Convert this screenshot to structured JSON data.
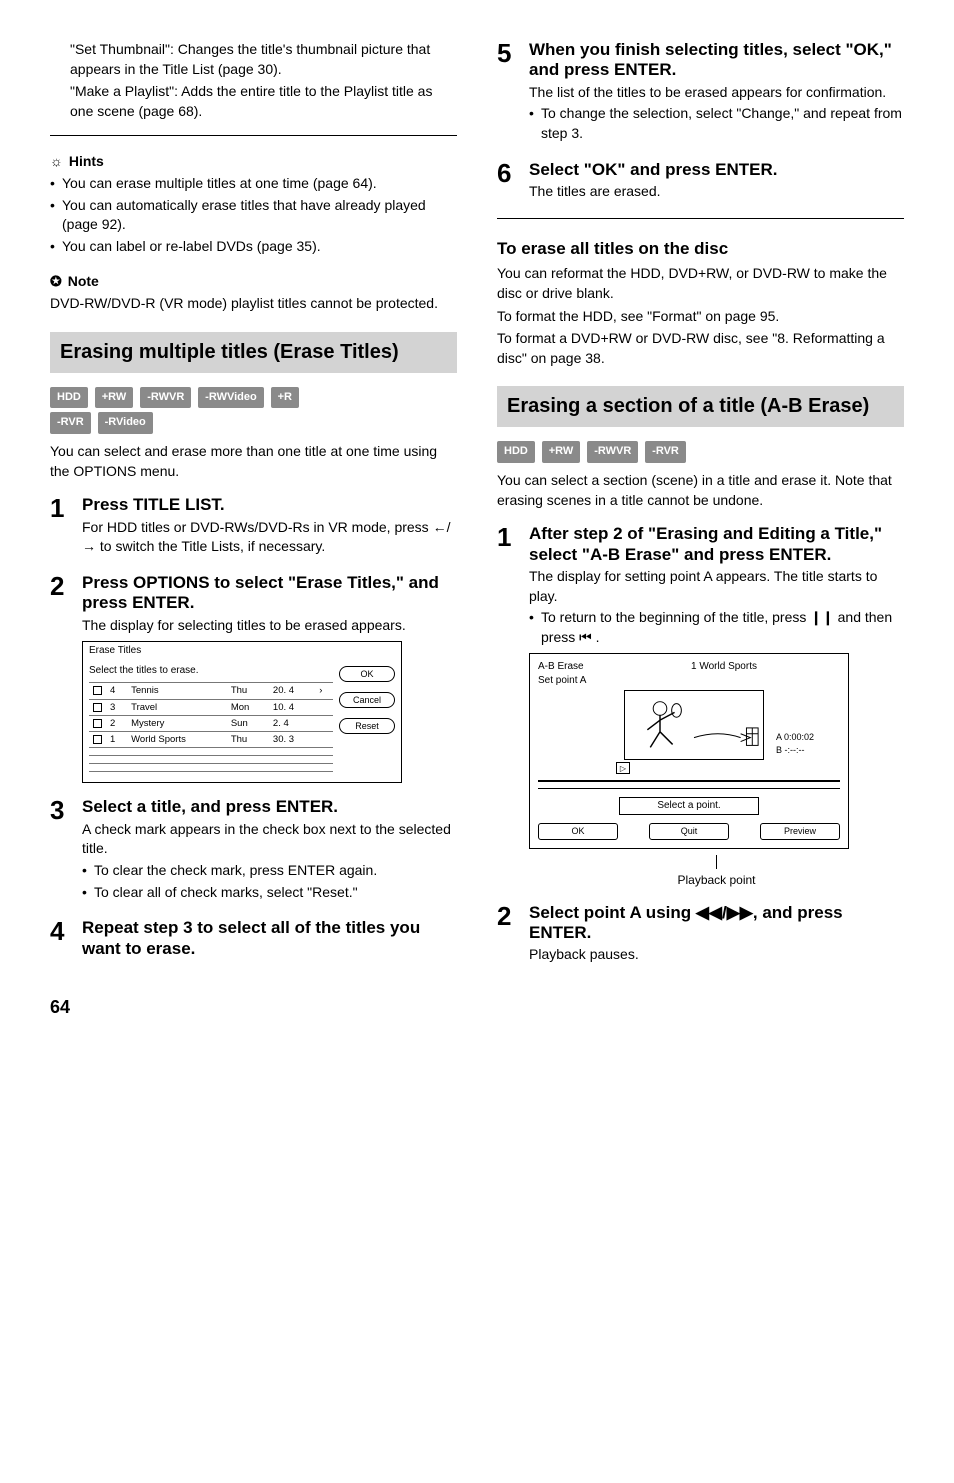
{
  "col1": {
    "intro1": "\"Set Thumbnail\": Changes the title's thumbnail picture that appears in the Title List (page 30).",
    "intro2": "\"Make a Playlist\": Adds the entire title to the Playlist title as one scene (page 68).",
    "hints_head": "Hints",
    "hints": [
      "You can erase multiple titles at one time (page 64).",
      "You can automatically erase titles that have already played (page 92).",
      "You can label or re-label DVDs (page 35)."
    ],
    "note_head": "Note",
    "note_text": "DVD-RW/DVD-R (VR mode) playlist titles cannot be protected.",
    "section1_title": "Erasing multiple titles (Erase Titles)",
    "badges1": [
      "HDD",
      "+RW",
      "-RWVR",
      "-RWVideo",
      "+R",
      "-RVR",
      "-RVideo"
    ],
    "sec1_intro": "You can select and erase more than one title at one time using the OPTIONS menu.",
    "steps1": [
      {
        "num": "1",
        "head": "Press TITLE LIST.",
        "body": [
          "For HDD titles or DVD-RWs/DVD-Rs in VR mode, press ←/→ to switch the Title Lists, if necessary."
        ]
      },
      {
        "num": "2",
        "head": "Press OPTIONS to select \"Erase Titles,\" and press ENTER.",
        "body": [
          "The display for selecting titles to be erased appears."
        ]
      }
    ],
    "dialog": {
      "title": "Erase Titles",
      "instr": "Select the titles to erase.",
      "rows": [
        {
          "n": "4",
          "name": "Tennis",
          "day": "Thu",
          "date": "20. 4"
        },
        {
          "n": "3",
          "name": "Travel",
          "day": "Mon",
          "date": "10. 4"
        },
        {
          "n": "2",
          "name": "Mystery",
          "day": "Sun",
          "date": "2. 4"
        },
        {
          "n": "1",
          "name": "World Sports",
          "day": "Thu",
          "date": "30. 3"
        }
      ],
      "btns": [
        "OK",
        "Cancel",
        "Reset"
      ]
    },
    "steps1b": [
      {
        "num": "3",
        "head": "Select a title, and press ENTER.",
        "body": [
          "A check mark appears in the check box next to the selected title."
        ],
        "subs": [
          "To clear the check mark, press ENTER again.",
          "To clear all of check marks, select \"Reset.\""
        ]
      },
      {
        "num": "4",
        "head": "Repeat step 3 to select all of the titles you want to erase."
      }
    ]
  },
  "col2": {
    "steps2": [
      {
        "num": "5",
        "head": "When you finish selecting titles, select \"OK,\" and press ENTER.",
        "body": [
          "The list of the titles to be erased appears for confirmation."
        ],
        "subs": [
          "To change the selection, select \"Change,\" and repeat from step 3."
        ]
      },
      {
        "num": "6",
        "head": "Select \"OK\" and press ENTER.",
        "body": [
          "The titles are erased."
        ]
      }
    ],
    "subhead": "To erase all titles on the disc",
    "sub_body": [
      "You can reformat the HDD, DVD+RW, or DVD-RW to make the disc or drive blank.",
      "To format the HDD, see \"Format\" on page 95.",
      "To format a DVD+RW or DVD-RW disc, see \"8. Reformatting a disc\" on page 38."
    ],
    "section2_title": "Erasing a section of a title (A-B Erase)",
    "badges2": [
      "HDD",
      "+RW",
      "-RWVR",
      "-RVR"
    ],
    "sec2_intro": "You can select a section (scene) in a title and erase it. Note that erasing scenes in a title cannot be undone.",
    "steps3": [
      {
        "num": "1",
        "head": "After step 2 of \"Erasing and Editing a Title,\" select \"A-B Erase\" and press ENTER.",
        "body": [
          "The display for setting point A appears. The title starts to play."
        ],
        "subs": [
          "To return to the beginning of the title, press ❙❙ and then press ⏮ ."
        ]
      }
    ],
    "ab": {
      "top_left": "A-B Erase",
      "top_left2": "Set point A",
      "top_right": "1 World Sports",
      "time1": "A 0:00:02",
      "time2": "B -:--:--",
      "select": "Select a point.",
      "btns": [
        "OK",
        "Quit",
        "Preview"
      ],
      "caption": "Playback point"
    },
    "steps3b": [
      {
        "num": "2",
        "head": "Select point A using ◀◀/▶▶, and press ENTER.",
        "body": [
          "Playback pauses."
        ]
      }
    ]
  },
  "page": "64"
}
